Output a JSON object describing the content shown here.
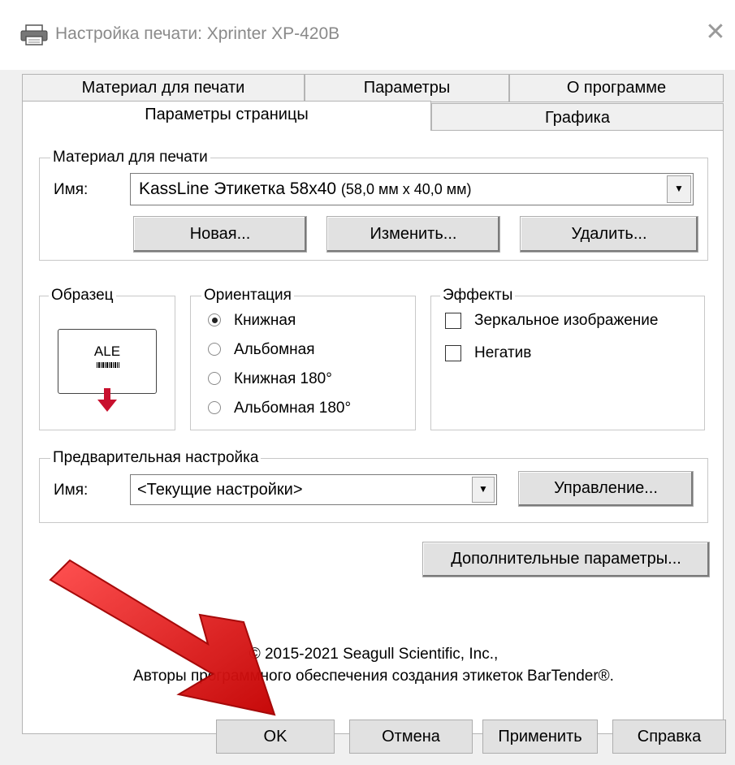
{
  "window": {
    "title": "Настройка печати: Xprinter XP-420B"
  },
  "tabs": {
    "row_back": [
      "Материал для печати",
      "Параметры",
      "О программе"
    ],
    "row_front": [
      "Параметры страницы",
      "Графика"
    ]
  },
  "media": {
    "legend": "Материал для печати",
    "name_label": "Имя:",
    "value": "KassLine Этикетка 58х40",
    "value_dims": "(58,0 мм x 40,0 мм)",
    "buttons": [
      "Новая...",
      "Изменить...",
      "Удалить..."
    ]
  },
  "sample": {
    "legend": "Образец",
    "text": "ALE"
  },
  "orientation": {
    "legend": "Ориентация",
    "options": [
      "Книжная",
      "Альбомная",
      "Книжная 180°",
      "Альбомная 180°"
    ],
    "selected": "Книжная"
  },
  "effects": {
    "legend": "Эффекты",
    "options": [
      {
        "label": "Зеркальное изображение",
        "checked": false
      },
      {
        "label": "Негатив",
        "checked": false
      }
    ]
  },
  "preset": {
    "legend": "Предварительная настройка",
    "name_label": "Имя:",
    "value": "<Текущие настройки>",
    "manage_label": "Управление..."
  },
  "advanced_label": "Дополнительные параметры...",
  "copyright": {
    "line1": "© 2015-2021 Seagull Scientific, Inc.,",
    "line2": "Авторы программного обеспечения создания этикеток BarTender®."
  },
  "footer": {
    "ok": "OK",
    "cancel": "Отмена",
    "apply": "Применить",
    "help": "Справка"
  },
  "colors": {
    "arrow": "#e8151b",
    "accent": "#0078d7"
  }
}
